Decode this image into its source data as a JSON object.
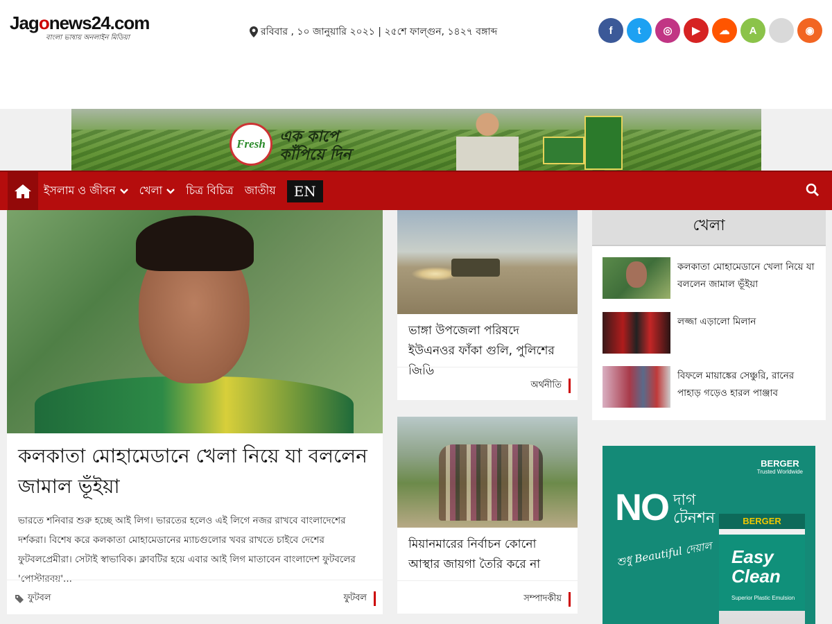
{
  "site": {
    "logo_text": "Jago news24.com",
    "logo_brand_a": "Jag",
    "logo_brand_o": "o",
    "logo_brand_b": "news24.com",
    "tagline": "বাংলা ভাষায় অনলাইন মিডিয়া"
  },
  "dateline": "রবিবার , ১০ জানুয়ারি ২০২১ | ২৫শে ফাল্গুন, ১৪২৭ বঙ্গাব্দ",
  "socials": [
    {
      "name": "facebook",
      "glyph": "f",
      "color": "#3b5998"
    },
    {
      "name": "twitter",
      "glyph": "t",
      "color": "#1da1f2"
    },
    {
      "name": "instagram",
      "glyph": "◎",
      "color": "#c13584"
    },
    {
      "name": "youtube",
      "glyph": "▶",
      "color": "#d62323"
    },
    {
      "name": "soundcloud",
      "glyph": "☁",
      "color": "#ff5500"
    },
    {
      "name": "android",
      "glyph": "A",
      "color": "#8bc34a"
    },
    {
      "name": "apple",
      "glyph": "",
      "color": "#d9d9d9"
    },
    {
      "name": "rss",
      "glyph": "◉",
      "color": "#f26522"
    }
  ],
  "top_banner": {
    "brand": "Fresh",
    "slogan_line1": "এক কাপে",
    "slogan_line2": "কাঁপিয়ে দিন"
  },
  "nav": {
    "items": [
      {
        "label": "ইসলাম ও জীবন",
        "dropdown": true
      },
      {
        "label": "খেলা",
        "dropdown": true
      },
      {
        "label": "চিত্র বিচিত্র",
        "dropdown": false
      },
      {
        "label": "জাতীয়",
        "dropdown": false
      }
    ],
    "lang_button": "EN"
  },
  "lead": {
    "title": "কলকাতা মোহামেডানে খেলা নিয়ে যা বললেন জামাল ভূঁইয়া",
    "summary": "ভারতে শনিবার শুরু হচ্ছে আই লিগ। ভারতের হলেও এই লিগে নজর রাখবে বাংলাদেশের দর্শকরা। বিশেষ করে কলকাতা মোহামেডানের ম্যাচগুলোর খবর রাখতে চাইবে দেশের ফুটবলপ্রেমীরা। সেটাই স্বাভাবিক। ক্লাবটির হয়ে এবার আই লিগ মাতাবেন বাংলাদেশ ফুটবলের 'পোস্টারবয়'...",
    "tag": "ফুটবল",
    "category": "ফুটবল"
  },
  "mid_stories": [
    {
      "title": "ভাঙ্গা উপজেলা পরিষদে ইউএনওর ফাঁকা গুলি, পুলিশের জিডি",
      "category": "অর্থনীতি"
    },
    {
      "title": "মিয়ানমারের নির্বাচন কোনো আস্থার জায়গা তৈরি করে না",
      "category": "সম্পাদকীয়"
    }
  ],
  "sidebar": {
    "heading": "খেলা",
    "items": [
      {
        "title": "কলকাতা মোহামেডানে খেলা নিয়ে যা বললেন জামাল ভূঁইয়া"
      },
      {
        "title": "লজ্জা এড়ালো মিলান"
      },
      {
        "title": "বিফলে মায়াঙ্কের সেঞ্চুরি, রানের পাহাড় গড়েও হারল পাঞ্জাব"
      }
    ]
  },
  "side_ad": {
    "brand": "BERGER",
    "brand_sub": "Trusted Worldwide",
    "no": "NO",
    "daag": "দাগ",
    "tension": "টেনশন",
    "beautiful": "শুধু Beautiful দেয়াল",
    "product_l1": "Easy",
    "product_l2": "Clean",
    "product_sub": "Superior Plastic Emulsion"
  }
}
